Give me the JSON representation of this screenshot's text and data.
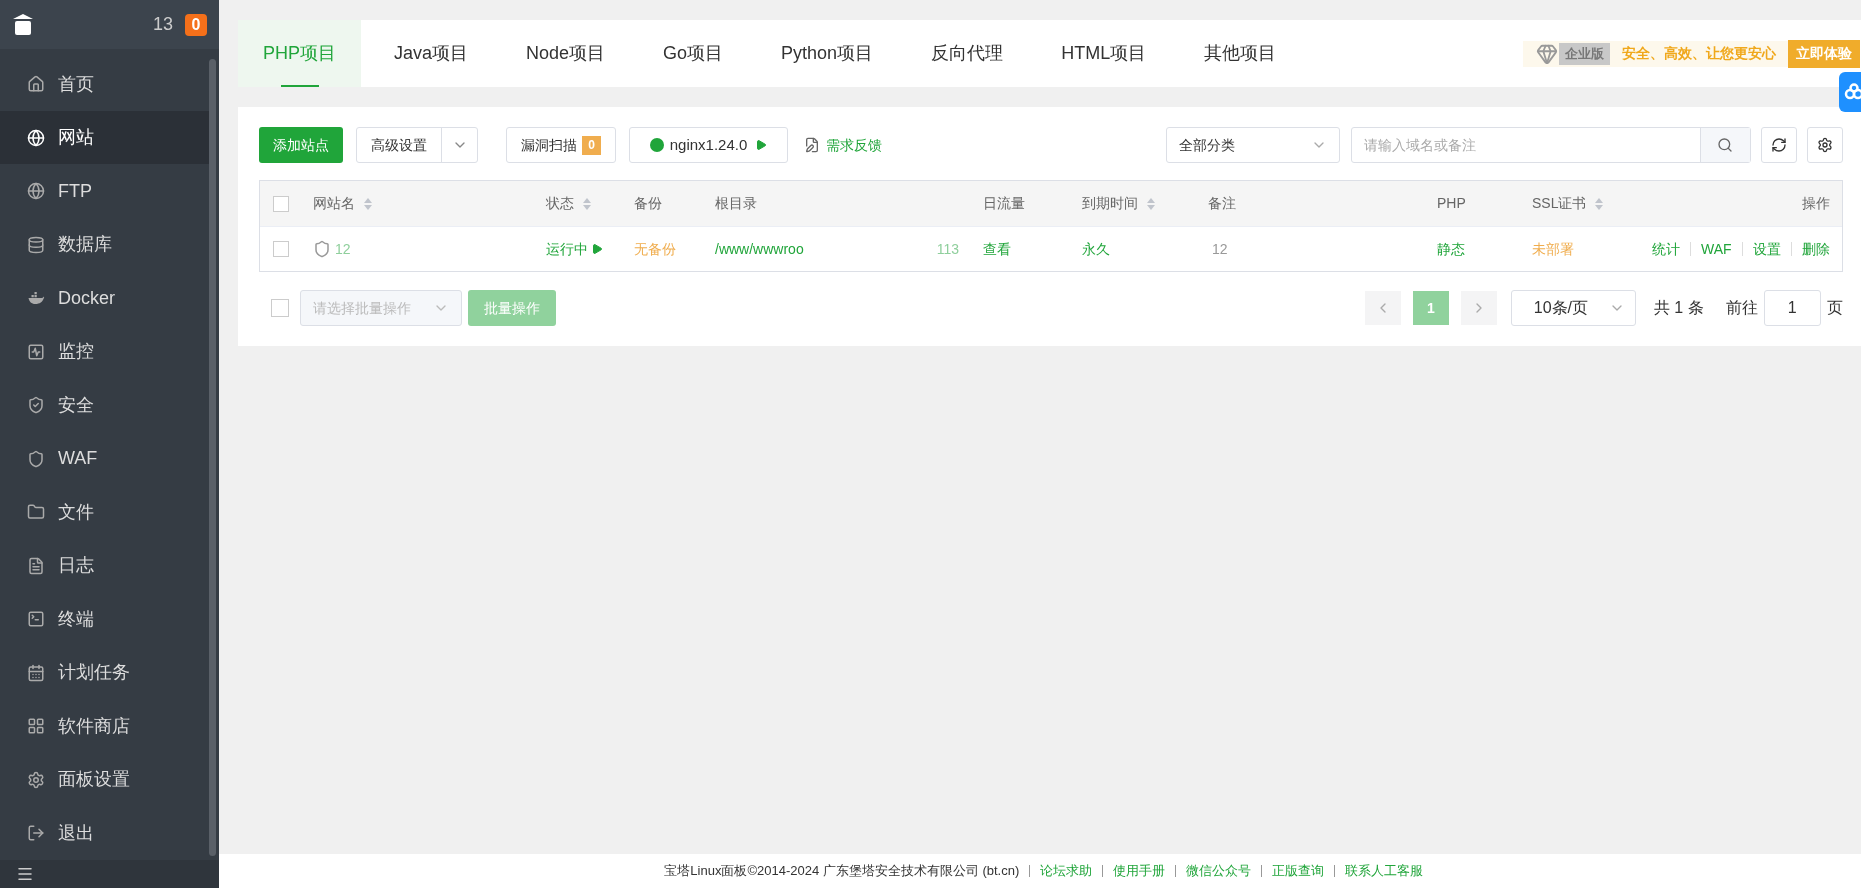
{
  "sidebar": {
    "header": {
      "server_name": "13",
      "badge": "0"
    },
    "items": [
      {
        "label": "首页",
        "selected": false
      },
      {
        "label": "网站",
        "selected": true
      },
      {
        "label": "FTP",
        "selected": false
      },
      {
        "label": "数据库",
        "selected": false
      },
      {
        "label": "Docker",
        "selected": false
      },
      {
        "label": "监控",
        "selected": false
      },
      {
        "label": "安全",
        "selected": false
      },
      {
        "label": "WAF",
        "selected": false
      },
      {
        "label": "文件",
        "selected": false
      },
      {
        "label": "日志",
        "selected": false
      },
      {
        "label": "终端",
        "selected": false
      },
      {
        "label": "计划任务",
        "selected": false
      },
      {
        "label": "软件商店",
        "selected": false
      },
      {
        "label": "面板设置",
        "selected": false
      },
      {
        "label": "退出",
        "selected": false
      }
    ]
  },
  "tabs": [
    {
      "label": "PHP项目",
      "selected": true
    },
    {
      "label": "Java项目",
      "selected": false
    },
    {
      "label": "Node项目",
      "selected": false
    },
    {
      "label": "Go项目",
      "selected": false
    },
    {
      "label": "Python项目",
      "selected": false
    },
    {
      "label": "反向代理",
      "selected": false
    },
    {
      "label": "HTML项目",
      "selected": false
    },
    {
      "label": "其他项目",
      "selected": false
    }
  ],
  "promo": {
    "edition": "企业版",
    "slogan": "安全、高效、让您更安心",
    "button": "立即体验"
  },
  "toolbar": {
    "add_site": "添加站点",
    "advanced": "高级设置",
    "scan": "漏洞扫描",
    "scan_count": "0",
    "server": "nginx1.24.0",
    "feedback": "需求反馈",
    "category": "全部分类",
    "search_placeholder": "请输入域名或备注"
  },
  "table": {
    "all_checked": false,
    "columns": [
      {
        "label": "网站名",
        "sortable": true
      },
      {
        "label": "状态",
        "sortable": true
      },
      {
        "label": "备份",
        "sortable": false
      },
      {
        "label": "根目录",
        "sortable": false
      },
      {
        "label": "日流量",
        "sortable": false
      },
      {
        "label": "到期时间",
        "sortable": true
      },
      {
        "label": "备注",
        "sortable": false
      },
      {
        "label": "PHP",
        "sortable": false
      },
      {
        "label": "SSL证书",
        "sortable": true
      },
      {
        "label": "操作",
        "sortable": false
      }
    ],
    "rows": [
      {
        "checked": false,
        "name": "12",
        "status": "运行中",
        "backup": "无备份",
        "root_start": "/www/wwwroo",
        "root_end": "113",
        "traffic": "查看",
        "expiry": "永久",
        "remark": "12",
        "php": "静态",
        "ssl": "未部署",
        "actions": [
          "统计",
          "WAF",
          "设置",
          "删除"
        ]
      }
    ]
  },
  "batch": {
    "checked": false,
    "placeholder": "请选择批量操作",
    "button": "批量操作"
  },
  "pagination": {
    "pages": [
      {
        "label": "1",
        "selected": true
      }
    ],
    "page_size": "10条/页",
    "total": "共 1 条",
    "goto_label": "前往",
    "goto_value": "1",
    "page_unit": "页"
  },
  "footer": {
    "copyright": "宝塔Linux面板©2014-2024 广东堡塔安全技术有限公司 (bt.cn)",
    "links": [
      "论坛求助",
      "使用手册",
      "微信公众号",
      "正版查询",
      "联系人工客服"
    ]
  }
}
